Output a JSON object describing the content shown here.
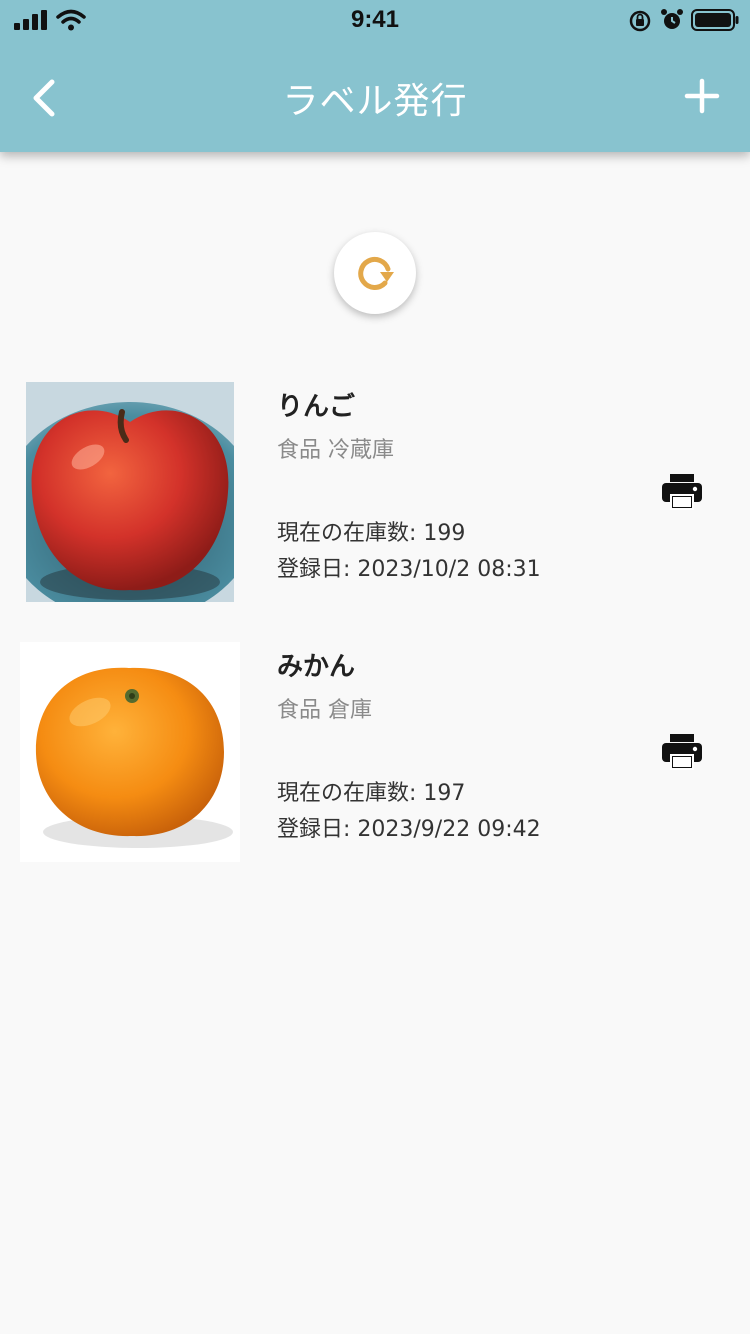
{
  "status_bar": {
    "time": "9:41"
  },
  "header": {
    "title": "ラベル発行",
    "back_icon": "chevron-left-icon",
    "add_icon": "plus-icon"
  },
  "colors": {
    "header_bg": "#88c3cf",
    "refresh_icon": "#e3a84a",
    "background": "#f9f9f9"
  },
  "items": [
    {
      "name": "りんご",
      "category": "食品 冷蔵庫",
      "stock": "現在の在庫数: 199",
      "date": "登録日: 2023/10/2 08:31",
      "image": "apple-photo"
    },
    {
      "name": "みかん",
      "category": "食品 倉庫",
      "stock": "現在の在庫数: 197",
      "date": "登録日: 2023/9/22 09:42",
      "image": "mandarin-orange-photo"
    }
  ]
}
